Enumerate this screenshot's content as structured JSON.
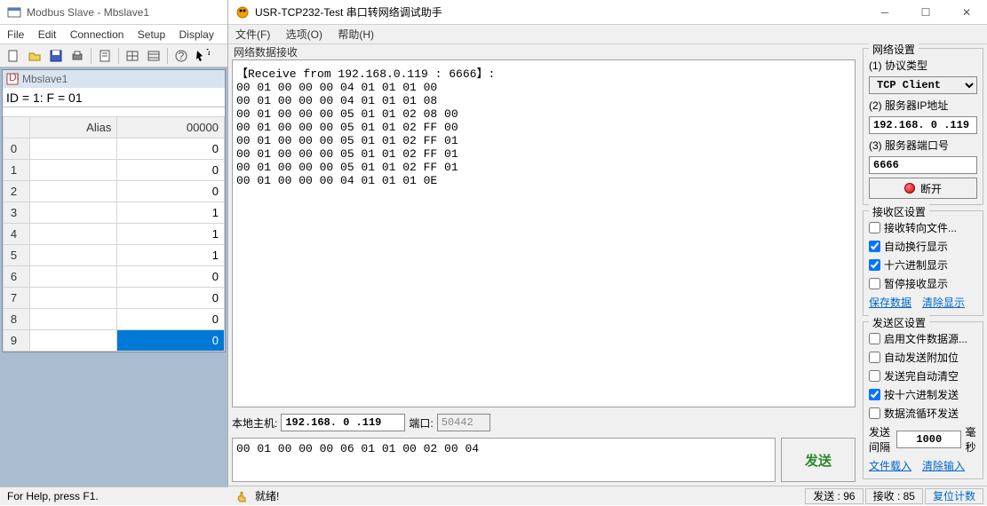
{
  "left": {
    "title": "Modbus Slave - Mbslave1",
    "menu": [
      "File",
      "Edit",
      "Connection",
      "Setup",
      "Display"
    ],
    "doc_title": "Mbslave1",
    "info": "ID = 1: F = 01",
    "headers": [
      "Alias",
      "00000"
    ],
    "rows": [
      {
        "n": "0",
        "alias": "",
        "val": "0"
      },
      {
        "n": "1",
        "alias": "",
        "val": "0"
      },
      {
        "n": "2",
        "alias": "",
        "val": "0"
      },
      {
        "n": "3",
        "alias": "",
        "val": "1"
      },
      {
        "n": "4",
        "alias": "",
        "val": "1"
      },
      {
        "n": "5",
        "alias": "",
        "val": "1"
      },
      {
        "n": "6",
        "alias": "",
        "val": "0"
      },
      {
        "n": "7",
        "alias": "",
        "val": "0"
      },
      {
        "n": "8",
        "alias": "",
        "val": "0"
      },
      {
        "n": "9",
        "alias": "",
        "val": "0",
        "selected": true
      }
    ],
    "status": "For Help, press F1."
  },
  "right": {
    "title": "USR-TCP232-Test 串口转网络调试助手",
    "menu": [
      "文件(F)",
      "选项(O)",
      "帮助(H)"
    ],
    "recv_label": "网络数据接收",
    "recv_text": "【Receive from 192.168.0.119 : 6666】:\n00 01 00 00 00 04 01 01 01 00\n00 01 00 00 00 04 01 01 01 08\n00 01 00 00 00 05 01 01 02 08 00\n00 01 00 00 00 05 01 01 02 FF 00\n00 01 00 00 00 05 01 01 02 FF 01\n00 01 00 00 00 05 01 01 02 FF 01\n00 01 00 00 00 05 01 01 02 FF 01\n00 01 00 00 00 04 01 01 01 0E",
    "local_host_label": "本地主机:",
    "local_host": "192.168. 0 .119",
    "port_label": "端口:",
    "port": "50442",
    "send_text": "00 01 00 00 00 06 01 01 00 02 00 04",
    "send_btn": "发送",
    "status": "就绪!",
    "tx_label": "发送",
    "tx_count": "96",
    "rx_label": "接收",
    "rx_count": "85",
    "reset_label": "复位计数",
    "network": {
      "title": "网络设置",
      "proto_label": "(1) 协议类型",
      "proto": "TCP Client",
      "ip_label": "(2) 服务器IP地址",
      "ip": "192.168. 0 .119",
      "port_label": "(3) 服务器端口号",
      "port": "6666",
      "disconnect": "断开"
    },
    "recv_opts": {
      "title": "接收区设置",
      "opt1": "接收转向文件...",
      "opt2": "自动换行显示",
      "opt3": "十六进制显示",
      "opt4": "暂停接收显示",
      "link1": "保存数据",
      "link2": "清除显示"
    },
    "send_opts": {
      "title": "发送区设置",
      "opt1": "启用文件数据源...",
      "opt2": "自动发送附加位",
      "opt3": "发送完自动清空",
      "opt4": "按十六进制发送",
      "opt5": "数据流循环发送",
      "interval_label": "发送间隔",
      "interval": "1000",
      "interval_unit": "毫秒",
      "link1": "文件载入",
      "link2": "清除输入"
    }
  }
}
